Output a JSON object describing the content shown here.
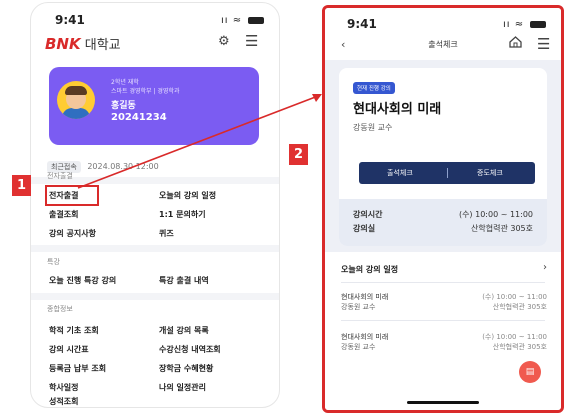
{
  "status": {
    "time": "9:41",
    "signal": "ıı",
    "wifi": "≈"
  },
  "phone1": {
    "logo": {
      "brand": "BNK",
      "suffix": " 대학교"
    },
    "profile": {
      "grade": "2학년 재학",
      "major": "스마트 경영학부 | 경영학과",
      "name": "홍길동",
      "student_id": "20241234"
    },
    "last_login_badge": "최근접속",
    "last_login_time": "2024.08.30  12:00",
    "sections": [
      {
        "title": "전자출결",
        "items": [
          "전자출결",
          "오늘의 강의 일정",
          "출결조회",
          "1:1 문의하기",
          "강의 공지사항",
          "퀴즈"
        ]
      },
      {
        "title": "특강",
        "items": [
          "오늘 진행 특강 강의",
          "특강 출결 내역"
        ]
      },
      {
        "title": "종합정보",
        "items": [
          "학적 기초 조회",
          "개설 강의 목록",
          "강의 시간표",
          "수강신청 내역조회",
          "등록금 납부 조회",
          "장학금 수혜현황",
          "학사일정",
          "나의 일정관리",
          "성적조회"
        ]
      }
    ]
  },
  "labels": {
    "one": "1",
    "two": "2"
  },
  "phone2": {
    "title": "출석체크",
    "tag": "현재 진행 강의",
    "lecture_name": "현대사회의 미래",
    "professor": "강동원 교수",
    "btn_attend": "출석체크",
    "btn_verify": "증도체크",
    "info_time_label": "강의시간",
    "info_time_value": "(수) 10:00 ~ 11:00",
    "info_room_label": "강의실",
    "info_room_value": "산학협력관 305호",
    "schedule_header": "오늘의 강의 일정",
    "schedule": [
      {
        "name": "현대사회의 미래",
        "prof": "강동원 교수",
        "time": "(수) 10:00 ~ 11:00",
        "room": "산학협력관 305호"
      },
      {
        "name": "현대사회의 미래",
        "prof": "강동원 교수",
        "time": "(수) 10:00 ~ 11:00",
        "room": "산학협력관 305호"
      }
    ]
  },
  "colors": {
    "accent_red": "#d92a2a",
    "card_purple": "#7b5cf2",
    "navy": "#1f3366",
    "tag_blue": "#3557d1",
    "fab": "#f05a4f"
  }
}
